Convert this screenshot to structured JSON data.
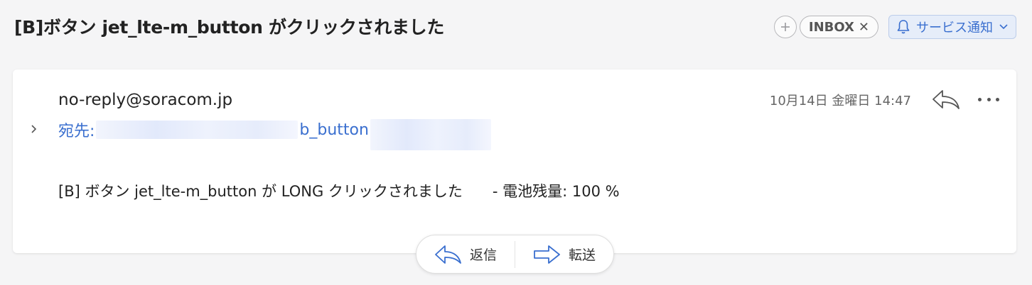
{
  "subject": "[B]ボタン jet_lte-m_button がクリックされました",
  "labels": {
    "add_label_symbol": "+",
    "inbox_tag": "INBOX",
    "inbox_remove_symbol": "✕",
    "folder_label": "サービス通知"
  },
  "message": {
    "sender": "no-reply@soracom.jp",
    "recipient_prefix": "宛先:",
    "recipient_visible_fragment": "b_button",
    "date": "10月14日 金曜日 14:47",
    "body": "[B] ボタン jet_lte-m_button が LONG クリックされました　　- 電池残量: 100 %"
  },
  "actions": {
    "reply_label": "返信",
    "forward_label": "転送"
  },
  "colors": {
    "accent_blue": "#3a6fcf",
    "background": "#f5f5f6",
    "card": "#ffffff"
  },
  "icons": [
    "add-icon",
    "close-icon",
    "bell-icon",
    "chevron-down-icon",
    "chevron-right-icon",
    "reply-icon",
    "more-icon",
    "forward-icon"
  ]
}
